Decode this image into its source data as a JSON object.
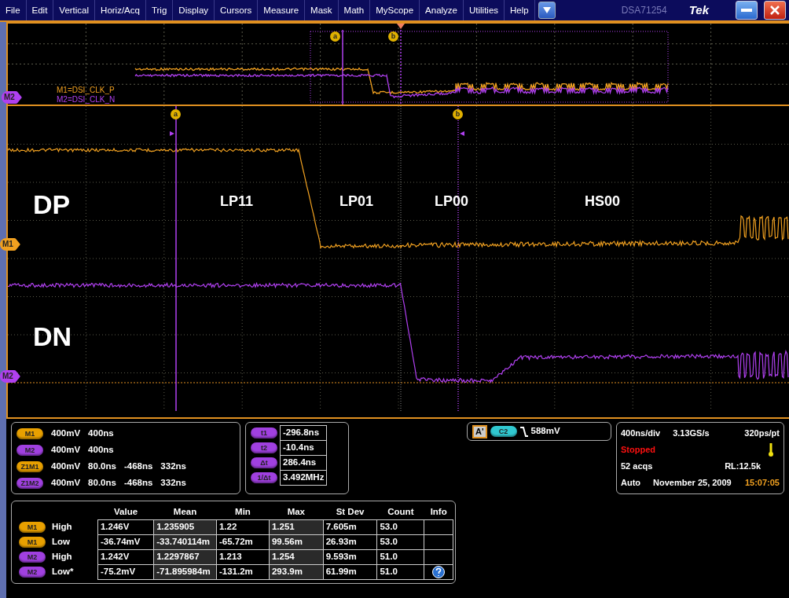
{
  "menu_bar": {
    "items": [
      "File",
      "Edit",
      "Vertical",
      "Horiz/Acq",
      "Trig",
      "Display",
      "Cursors",
      "Measure",
      "Mask",
      "Math",
      "MyScope",
      "Analyze",
      "Utilities",
      "Help"
    ],
    "model": "DSA71254",
    "brand": "Tek"
  },
  "overview": {
    "traces": [
      {
        "label": "M1=DSI_CLK_P",
        "color": "#f0a020"
      },
      {
        "label": "M2=DSI_CLK_N",
        "color": "#b040f0"
      }
    ],
    "cursors": [
      "a",
      "b"
    ],
    "marker": "M2"
  },
  "waveform": {
    "cursors": [
      "a",
      "b"
    ],
    "trace_names": [
      "DP",
      "DN"
    ],
    "states": [
      "LP11",
      "LP01",
      "LP00",
      "HS00"
    ],
    "markers": [
      {
        "label": "M1",
        "color": "#f0a020"
      },
      {
        "label": "M2",
        "color": "#b040f0"
      }
    ]
  },
  "channel_readouts": [
    {
      "badge": "M1",
      "color": "#e8a000",
      "values": [
        "400mV",
        "400ns"
      ]
    },
    {
      "badge": "M2",
      "color": "#a040e0",
      "values": [
        "400mV",
        "400ns"
      ]
    },
    {
      "badge": "Z1M1",
      "color": "#e8a000",
      "values": [
        "400mV",
        "80.0ns",
        "-468ns",
        "332ns"
      ]
    },
    {
      "badge": "Z1M2",
      "color": "#a040e0",
      "values": [
        "400mV",
        "80.0ns",
        "-468ns",
        "332ns"
      ]
    }
  ],
  "cursor_readouts": [
    {
      "label": "t1",
      "value": "-296.8ns"
    },
    {
      "label": "t2",
      "value": "-10.4ns"
    },
    {
      "label": "Δt",
      "value": "286.4ns"
    },
    {
      "label": "1/Δt",
      "value": "3.492MHz"
    }
  ],
  "trigger": {
    "label": "A'",
    "source": "C2",
    "threshold": "588mV"
  },
  "acquisition": {
    "timebase": "400ns/div",
    "sample_rate": "3.13GS/s",
    "resolution": "320ps/pt",
    "status": "Stopped",
    "acquisitions": "52 acqs",
    "record_length": "RL:12.5k",
    "mode": "Auto",
    "date": "November 25, 2009",
    "time": "15:07:05"
  },
  "measurements": {
    "columns": [
      "Value",
      "Mean",
      "Min",
      "Max",
      "St Dev",
      "Count",
      "Info"
    ],
    "rows": [
      {
        "badge": "M1",
        "color": "#e8a000",
        "name": "High",
        "cells": [
          "1.246V",
          "1.235905",
          "1.22",
          "1.251",
          "7.605m",
          "53.0"
        ],
        "info": false
      },
      {
        "badge": "M1",
        "color": "#e8a000",
        "name": "Low",
        "cells": [
          "-36.74mV",
          "-33.740114m",
          "-65.72m",
          "99.56m",
          "26.93m",
          "53.0"
        ],
        "info": false
      },
      {
        "badge": "M2",
        "color": "#a040e0",
        "name": "High",
        "cells": [
          "1.242V",
          "1.2297867",
          "1.213",
          "1.254",
          "9.593m",
          "51.0"
        ],
        "info": false
      },
      {
        "badge": "M2",
        "color": "#a040e0",
        "name": "Low*",
        "cells": [
          "-75.2mV",
          "-71.895984m",
          "-131.2m",
          "293.9m",
          "61.99m",
          "51.0"
        ],
        "info": true
      }
    ]
  }
}
